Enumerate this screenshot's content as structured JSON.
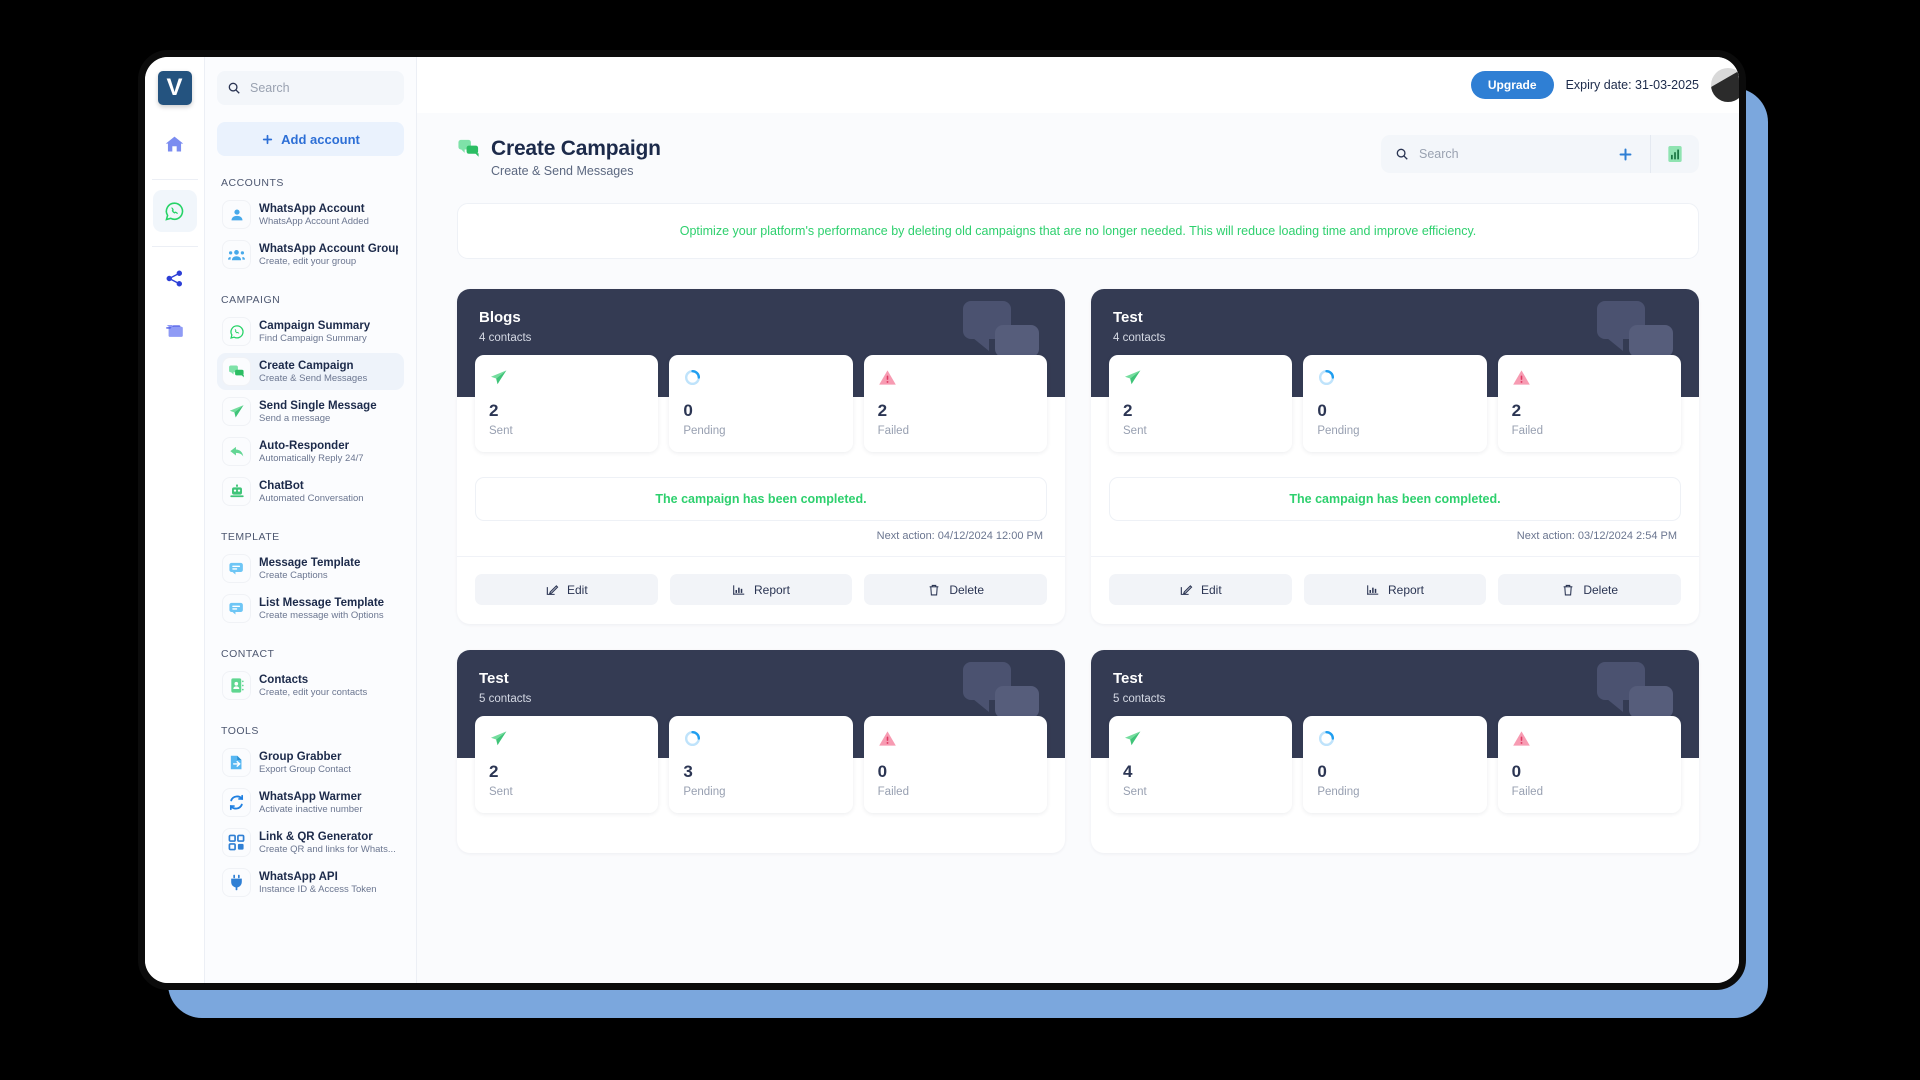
{
  "rail": {
    "logo": "V",
    "items": [
      {
        "name": "home-icon"
      },
      {
        "name": "whatsapp-icon",
        "active": true
      },
      {
        "name": "share-icon"
      },
      {
        "name": "folder-icon"
      }
    ]
  },
  "sidebar": {
    "search": {
      "placeholder": "Search",
      "value": ""
    },
    "add_account_label": "Add account",
    "groups": [
      {
        "label": "ACCOUNTS",
        "items": [
          {
            "title": "WhatsApp Account",
            "sub": "WhatsApp Account Added",
            "icon": "user-icon",
            "active": false
          },
          {
            "title": "WhatsApp Account Group",
            "sub": "Create, edit your group",
            "icon": "users-icon",
            "active": false
          }
        ]
      },
      {
        "label": "CAMPAIGN",
        "items": [
          {
            "title": "Campaign Summary",
            "sub": "Find Campaign Summary",
            "icon": "whatsapp-icon",
            "active": false
          },
          {
            "title": "Create Campaign",
            "sub": "Create & Send Messages",
            "icon": "chat-bubbles-icon",
            "active": true
          },
          {
            "title": "Send Single Message",
            "sub": "Send a message",
            "icon": "paper-plane-icon",
            "active": false
          },
          {
            "title": "Auto-Responder",
            "sub": "Automatically Reply 24/7",
            "icon": "reply-arrow-icon",
            "active": false
          },
          {
            "title": "ChatBot",
            "sub": "Automated Conversation",
            "icon": "robot-icon",
            "active": false
          }
        ]
      },
      {
        "label": "TEMPLATE",
        "items": [
          {
            "title": "Message Template",
            "sub": "Create Captions",
            "icon": "message-template-icon",
            "active": false
          },
          {
            "title": "List Message Template",
            "sub": "Create message with Options",
            "icon": "list-message-icon",
            "active": false
          }
        ]
      },
      {
        "label": "CONTACT",
        "items": [
          {
            "title": "Contacts",
            "sub": "Create, edit your contacts",
            "icon": "contact-book-icon",
            "active": false
          }
        ]
      },
      {
        "label": "TOOLS",
        "items": [
          {
            "title": "Group Grabber",
            "sub": "Export Group Contact",
            "icon": "export-file-icon",
            "active": false
          },
          {
            "title": "WhatsApp Warmer",
            "sub": "Activate inactive number",
            "icon": "refresh-icon",
            "active": false
          },
          {
            "title": "Link & QR Generator",
            "sub": "Create QR and links for Whats...",
            "icon": "qr-code-icon",
            "active": false
          },
          {
            "title": "WhatsApp API",
            "sub": "Instance ID & Access Token",
            "icon": "plug-icon",
            "active": false
          }
        ]
      }
    ]
  },
  "topbar": {
    "upgrade_label": "Upgrade",
    "expiry_text": "Expiry date: 31-03-2025"
  },
  "page": {
    "title": "Create Campaign",
    "subtitle": "Create & Send Messages",
    "search": {
      "placeholder": "Search",
      "value": ""
    },
    "banner_text": "Optimize your platform's performance by deleting old campaigns that are no longer needed. This will reduce loading time and improve efficiency."
  },
  "actions": {
    "edit": "Edit",
    "report": "Report",
    "delete": "Delete"
  },
  "stat_labels": {
    "sent": "Sent",
    "pending": "Pending",
    "failed": "Failed"
  },
  "colors": {
    "accent_blue": "#2f7fd4",
    "success_green": "#2ed06e",
    "card_dark": "#343b53",
    "failed_red": "#f06a8a",
    "pending_blue": "#1f9ef0",
    "sent_green": "#46c97f"
  },
  "campaigns": [
    {
      "name": "Blogs",
      "contacts": "4 contacts",
      "sent": "2",
      "pending": "0",
      "failed": "2",
      "status": "The campaign has been completed.",
      "next_action": "Next action: 04/12/2024 12:00 PM"
    },
    {
      "name": "Test",
      "contacts": "4 contacts",
      "sent": "2",
      "pending": "0",
      "failed": "2",
      "status": "The campaign has been completed.",
      "next_action": "Next action: 03/12/2024 2:54 PM"
    },
    {
      "name": "Test",
      "contacts": "5 contacts",
      "sent": "2",
      "pending": "3",
      "failed": "0",
      "status": "",
      "next_action": ""
    },
    {
      "name": "Test",
      "contacts": "5 contacts",
      "sent": "4",
      "pending": "0",
      "failed": "0",
      "status": "",
      "next_action": ""
    }
  ]
}
